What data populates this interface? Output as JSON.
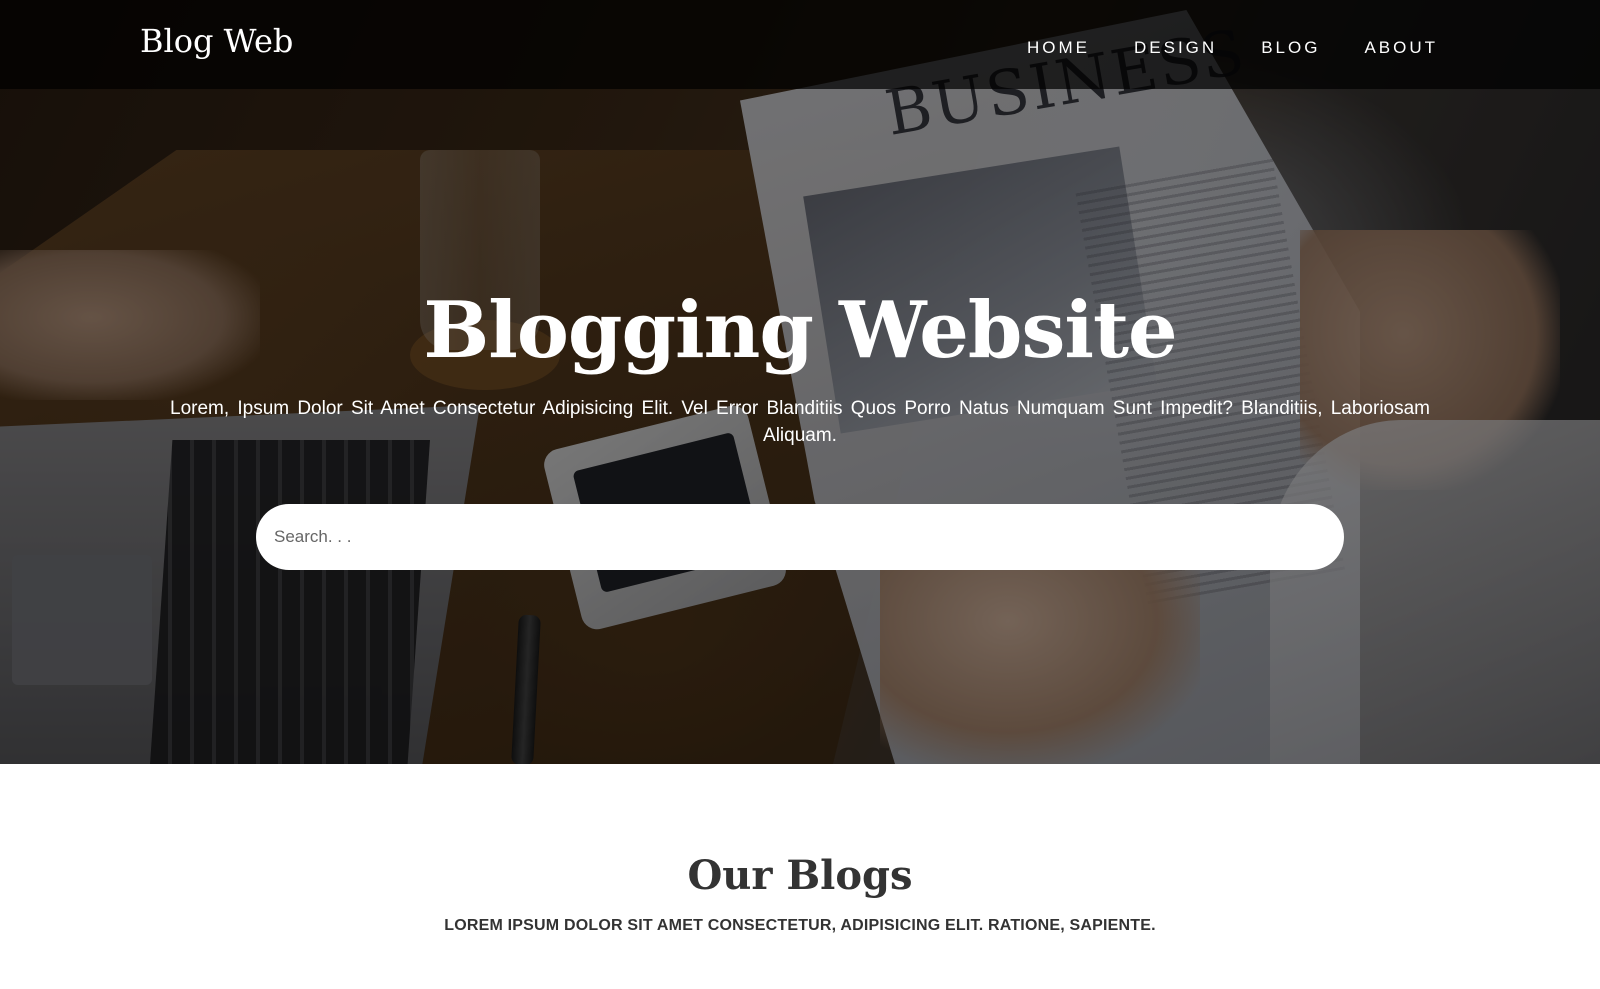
{
  "navbar": {
    "brand": "Blog Web",
    "links": [
      "HOME",
      "DESIGN",
      "BLOG",
      "ABOUT"
    ]
  },
  "hero": {
    "background_image": "newspaper-business-desk-photo",
    "newspaper_headline": "BUSINESS",
    "title": "Blogging Website",
    "subtitle": "Lorem, Ipsum Dolor Sit Amet Consectetur Adipisicing Elit. Vel Error Blanditiis Quos Porro Natus Numquam Sunt Impedit? Blanditiis, Laboriosam Aliquam.",
    "search": {
      "placeholder": "Search. . .",
      "value": ""
    }
  },
  "blogs": {
    "title": "Our Blogs",
    "subtitle": "LOREM IPSUM DOLOR SIT AMET CONSECTETUR, ADIPISICING ELIT. RATIONE, SAPIENTE."
  },
  "colors": {
    "navbar_bg": "#000000",
    "text_light": "#ffffff",
    "text_dark": "#333333",
    "page_bg": "#ffffff"
  }
}
